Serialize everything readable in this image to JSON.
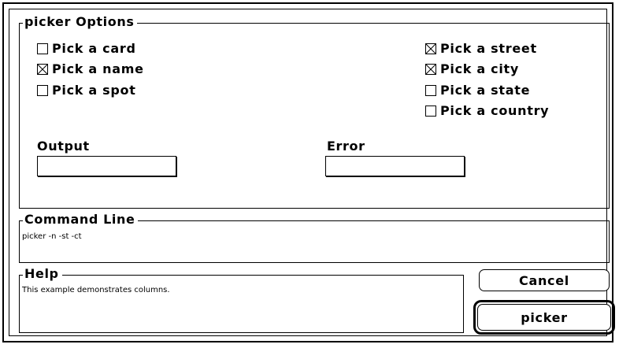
{
  "options_group": {
    "title": "picker Options",
    "checkboxes_left": [
      {
        "label": "Pick a card",
        "checked": false
      },
      {
        "label": "Pick a name",
        "checked": true
      },
      {
        "label": "Pick a spot",
        "checked": false
      }
    ],
    "checkboxes_right": [
      {
        "label": "Pick a street",
        "checked": true
      },
      {
        "label": "Pick a city",
        "checked": true
      },
      {
        "label": "Pick a state",
        "checked": false
      },
      {
        "label": "Pick a country",
        "checked": false
      }
    ],
    "output_label": "Output",
    "output_value": "",
    "error_label": "Error",
    "error_value": ""
  },
  "command_line": {
    "title": "Command Line",
    "text": "picker -n -st -ct"
  },
  "help": {
    "title": "Help",
    "text": "This example demonstrates columns."
  },
  "buttons": {
    "cancel_label": "Cancel",
    "default_label": "picker"
  }
}
